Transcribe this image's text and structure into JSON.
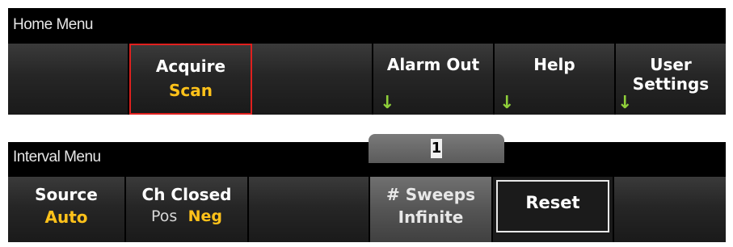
{
  "home_menu": {
    "title": "Home Menu",
    "softkeys": [
      {
        "line1": "",
        "line2": ""
      },
      {
        "line1": "Acquire",
        "line2": "Scan",
        "selected": true
      },
      {
        "line1": "",
        "line2": ""
      },
      {
        "line1": "Alarm Out",
        "line2": "",
        "submenu_arrow": "down-arrow-icon"
      },
      {
        "line1": "Help",
        "line2": "",
        "submenu_arrow": "down-arrow-icon"
      },
      {
        "line1": "User",
        "line2": "Settings",
        "submenu_arrow": "down-arrow-icon"
      }
    ]
  },
  "interval_menu": {
    "title": "Interval Menu",
    "value_entry": "1",
    "softkeys": [
      {
        "line1": "Source",
        "line2": "Auto"
      },
      {
        "line1": "Ch Closed",
        "option_a": "Pos",
        "option_b": "Neg",
        "selected_option": "Neg"
      },
      {
        "line1": "",
        "line2": ""
      },
      {
        "line1": "# Sweeps",
        "line2": "Infinite",
        "active": true
      },
      {
        "line1": "Reset"
      },
      {
        "line1": "",
        "line2": ""
      }
    ]
  },
  "colors": {
    "accent_value": "#ffc21a",
    "selection_border": "#e0201e",
    "submenu_arrow": "#8fcf3a",
    "panel_background": "#000000"
  }
}
